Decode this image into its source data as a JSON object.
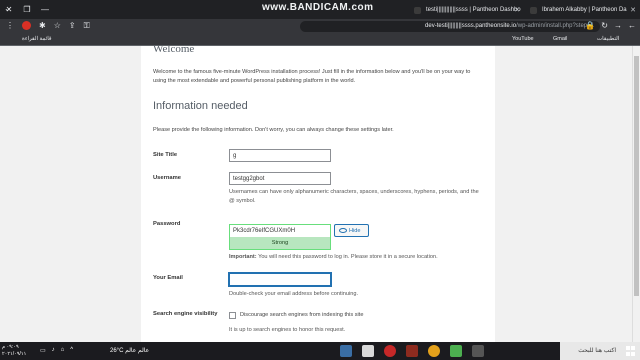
{
  "browser": {
    "watermark": "www.BANDICAM.com",
    "tabs": [
      {
        "title": "testi||||||||||||ssss | Pantheon Dashbo"
      },
      {
        "title": "Ibrahem Alkabby | Pantheon Da"
      }
    ],
    "url_host": "dev-testi|||||||||ssss.pantheonsite.io",
    "url_path": "/wp-admin/install.php?step=1",
    "bookmarks": [
      "YouTube",
      "Gmail",
      "التطبيقات",
      "قائمة القراءة"
    ]
  },
  "wp": {
    "welcome_heading": "Welcome",
    "intro": "Welcome to the famous five-minute WordPress installation process! Just fill in the information below and you'll be on your way to using the most extendable and powerful personal publishing platform in the world.",
    "info_heading": "Information needed",
    "provide_text": "Please provide the following information. Don't worry, you can always change these settings later.",
    "site_title": {
      "label": "Site Title",
      "value": "g"
    },
    "username": {
      "label": "Username",
      "value": "testgg2gbot",
      "hint": "Usernames can have only alphanumeric characters, spaces, underscores, hyphens, periods, and the @ symbol."
    },
    "password": {
      "label": "Password",
      "value": "Pk3cdr76eIfCGUXm0H",
      "strength": "Strong",
      "hide_label": "Hide",
      "important_bold": "Important:",
      "important_text": " You will need this password to log in. Please store it in a secure location."
    },
    "email": {
      "label": "Your Email",
      "value": "",
      "hint": "Double-check your email address before continuing."
    },
    "search": {
      "label": "Search engine visibility",
      "checkbox_label": "Discourage search engines from indexing this site",
      "hint": "It is up to search engines to honor this request."
    }
  },
  "taskbar": {
    "search_placeholder": "اكتب هنا للبحث",
    "weather": "26°C عالم عالم",
    "clock_time": "٠٩:٠٩ م",
    "clock_date": "٢٠٢١/٠٩/١١"
  }
}
